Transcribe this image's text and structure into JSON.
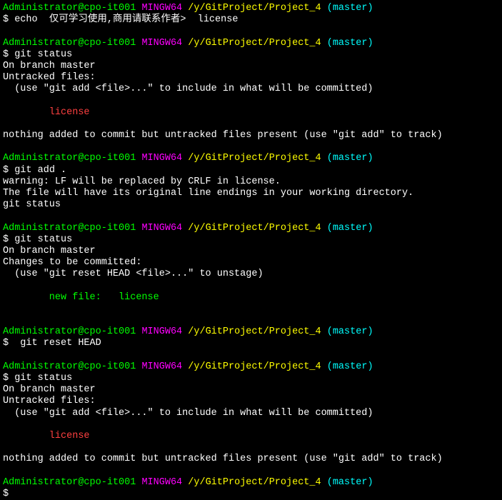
{
  "prompt": {
    "user": "Administrator@cpo-it001",
    "mingw": "MINGW64",
    "path": "/y/GitProject/Project_4",
    "branch": "(master)",
    "symbol": "$"
  },
  "block1": {
    "cmd": " echo  仅可学习使用,商用请联系作者>  license"
  },
  "block2": {
    "cmd": " git status",
    "l1": "On branch master",
    "l2": "Untracked files:",
    "l3": "  (use \"git add <file>...\" to include in what will be committed)",
    "file": "        license",
    "l4": "nothing added to commit but untracked files present (use \"git add\" to track)"
  },
  "block3": {
    "cmd": " git add .",
    "l1": "warning: LF will be replaced by CRLF in license.",
    "l2": "The file will have its original line endings in your working directory.",
    "l3": "git status"
  },
  "block4": {
    "cmd": " git status",
    "l1": "On branch master",
    "l2": "Changes to be committed:",
    "l3": "  (use \"git reset HEAD <file>...\" to unstage)",
    "file": "        new file:   license"
  },
  "block5": {
    "cmd": "  git reset HEAD"
  },
  "block6": {
    "cmd": " git status",
    "l1": "On branch master",
    "l2": "Untracked files:",
    "l3": "  (use \"git add <file>...\" to include in what will be committed)",
    "file": "        license",
    "l4": "nothing added to commit but untracked files present (use \"git add\" to track)"
  }
}
